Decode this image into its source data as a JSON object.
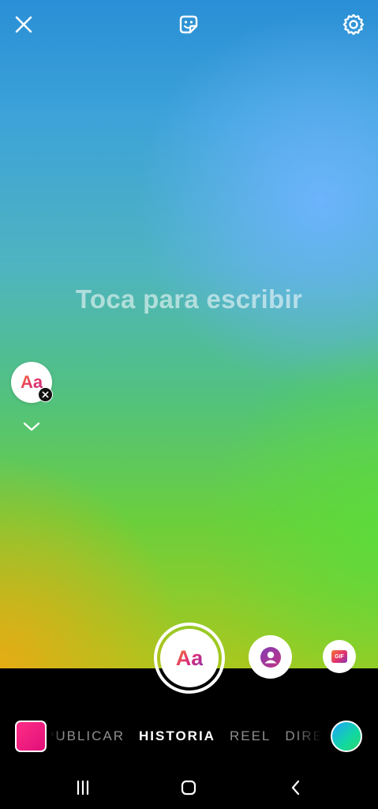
{
  "canvas": {
    "placeholder": "Toca para escribir"
  },
  "top_bar": {
    "close_icon": "close-icon",
    "sticker_icon": "sticker-icon",
    "settings_icon": "gear-icon"
  },
  "font_toggle": {
    "label": "Aa"
  },
  "capture": {
    "label": "Aa"
  },
  "effects": {
    "mention_icon": "mention-icon",
    "gif_label": "GIF"
  },
  "modes": [
    {
      "label": "PUBLICAR"
    },
    {
      "label": "HISTORIA"
    },
    {
      "label": "REEL"
    },
    {
      "label": "DIRECTO"
    }
  ],
  "active_mode": "HISTORIA",
  "colors": {
    "accent_pink": "#e1306c",
    "gallery_thumb": "#ff2d86",
    "background_gradient": [
      "#2a8fd6",
      "#52c27c",
      "#e8aa14"
    ]
  },
  "system_nav": {
    "recents_icon": "recents-icon",
    "home_icon": "home-icon",
    "back_icon": "back-icon"
  }
}
